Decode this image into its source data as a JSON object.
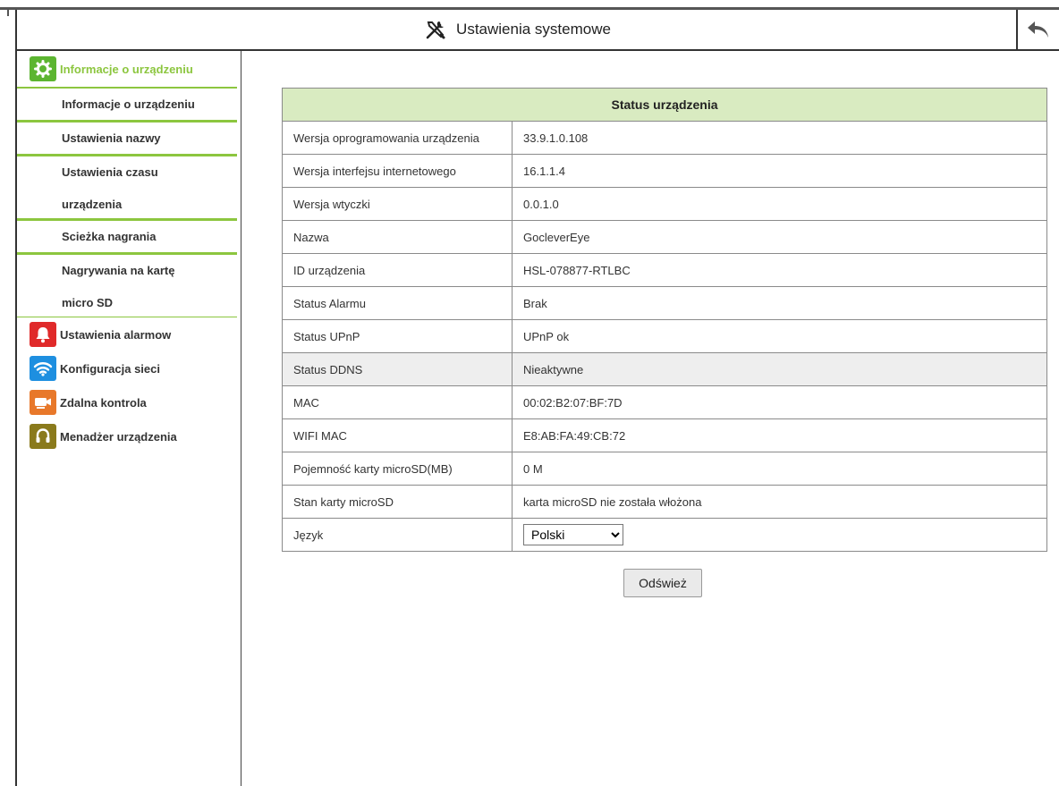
{
  "header": {
    "title": "Ustawienia systemowe",
    "title_icon": "tools-icon",
    "back_icon": "undo-arrow-icon"
  },
  "sidebar": {
    "groups": [
      {
        "label": "Informacje o urządzeniu",
        "icon": "gear-icon",
        "color": "#5cb531",
        "active": true,
        "items": [
          {
            "label": "Informacje o urządzeniu"
          },
          {
            "label": "Ustawienia nazwy"
          },
          {
            "line1": "Ustawienia czasu",
            "line2": "urządzenia"
          },
          {
            "label": "Scieżka nagrania"
          },
          {
            "line1": "Nagrywania na kartę",
            "line2": "micro SD"
          }
        ]
      },
      {
        "label": "Ustawienia alarmow",
        "icon": "bell-icon",
        "color": "#e02a2a"
      },
      {
        "label": "Konfiguracja sieci",
        "icon": "wifi-icon",
        "color": "#1e8fe0"
      },
      {
        "label": "Zdalna kontrola",
        "icon": "camera-icon",
        "color": "#e8782a"
      },
      {
        "label": "Menadżer urządzenia",
        "icon": "headset-icon",
        "color": "#8a7a1c"
      }
    ]
  },
  "status_table": {
    "title": "Status urządzenia",
    "rows": [
      {
        "key": "Wersja oprogramowania urządzenia",
        "value": "33.9.1.0.108"
      },
      {
        "key": "Wersja interfejsu internetowego",
        "value": "16.1.1.4"
      },
      {
        "key": "Wersja wtyczki",
        "value": "0.0.1.0"
      },
      {
        "key": "Nazwa",
        "value": "GocleverEye"
      },
      {
        "key": "ID urządzenia",
        "value": "HSL-078877-RTLBC"
      },
      {
        "key": "Status Alarmu",
        "value": "Brak"
      },
      {
        "key": "Status UPnP",
        "value": "UPnP ok"
      },
      {
        "key": "Status DDNS",
        "value": "Nieaktywne"
      },
      {
        "key": "MAC",
        "value": "00:02:B2:07:BF:7D"
      },
      {
        "key": "WIFI MAC",
        "value": "E8:AB:FA:49:CB:72"
      },
      {
        "key": "Pojemność karty microSD(MB)",
        "value": "0 M"
      },
      {
        "key": "Stan karty microSD",
        "value": "karta microSD nie została włożona"
      }
    ],
    "language": {
      "key": "Język",
      "selected": "Polski",
      "options": [
        "Polski"
      ]
    }
  },
  "refresh_button": "Odśwież",
  "colors": {
    "accent": "#8cc63f",
    "table_header_bg": "#d9ebc1"
  }
}
